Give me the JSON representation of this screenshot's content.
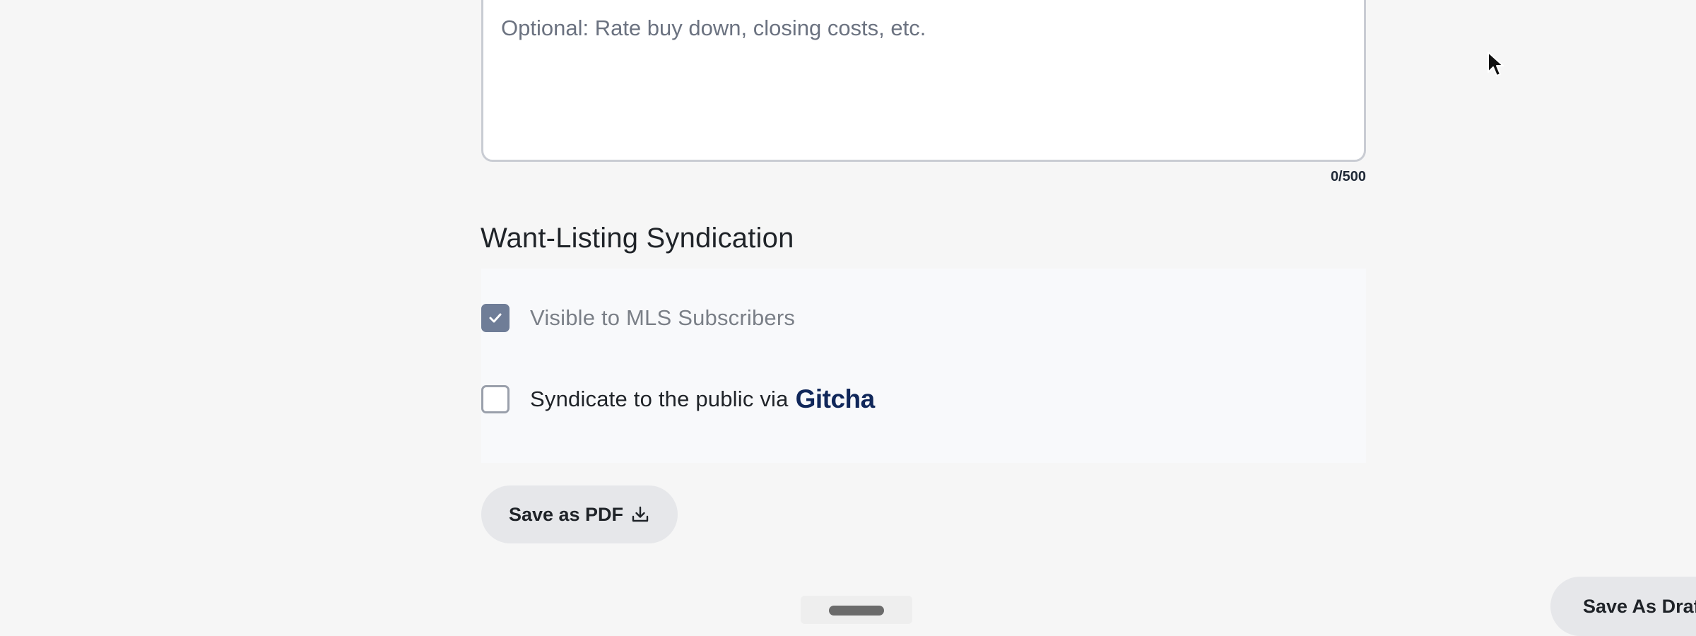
{
  "notes": {
    "placeholder": "Optional: Rate buy down, closing costs, etc.",
    "value": "",
    "counter": "0/500"
  },
  "syndication": {
    "title": "Want-Listing Syndication",
    "options": [
      {
        "label": "Visible to MLS Subscribers",
        "checked": true
      },
      {
        "label": "Syndicate to the public via",
        "checked": false,
        "brand": "Gitcha"
      }
    ]
  },
  "actions": {
    "save_pdf": "Save as PDF",
    "save_pdf_icon": "download-icon",
    "save_draft": "Save As Draft"
  },
  "colors": {
    "checkbox_checked": "#6f7d97",
    "gitcha_brand": "#10275a",
    "button_bg": "#e6e7ea"
  }
}
